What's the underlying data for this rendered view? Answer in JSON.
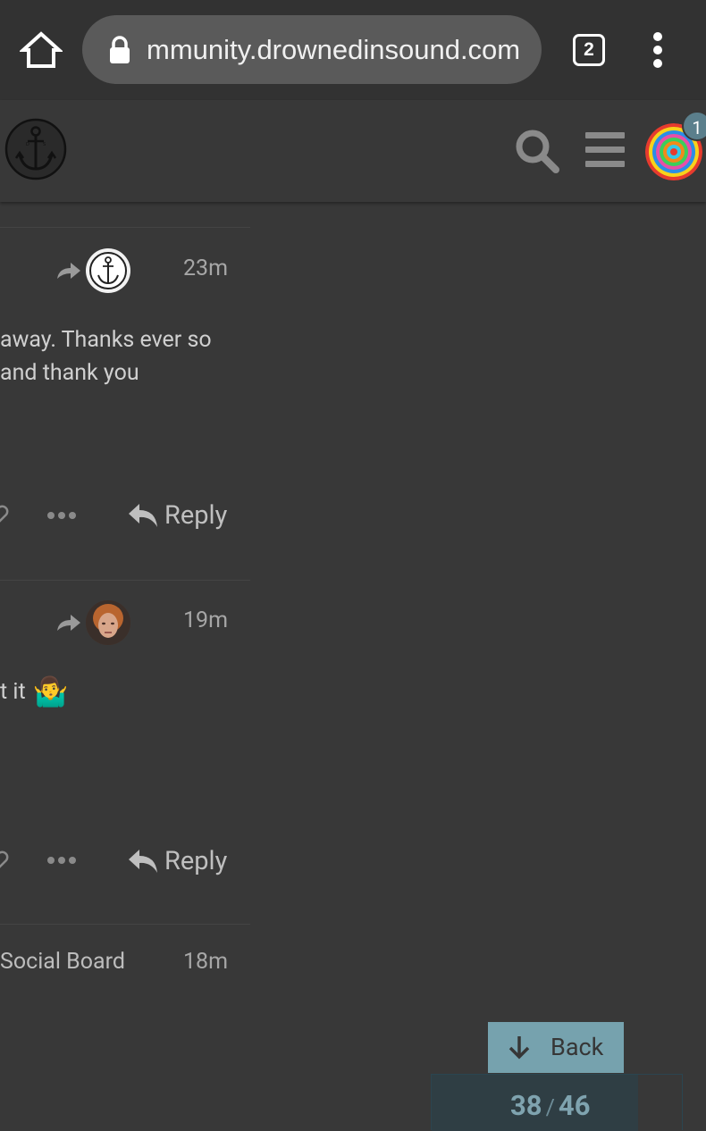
{
  "browser": {
    "url": "mmunity.drownedinsound.com",
    "tab_count": "2"
  },
  "header": {
    "notification_count": "1"
  },
  "posts": [
    {
      "timestamp": "23m",
      "lines": [
        "away. Thanks ever so",
        "and thank you"
      ],
      "reply_label": "Reply"
    },
    {
      "timestamp": "19m",
      "lines": [
        "t it"
      ],
      "emoji": "🤷‍♂️",
      "reply_label": "Reply"
    },
    {
      "category": "Social Board",
      "timestamp": "18m"
    }
  ],
  "navigation": {
    "back_label": "Back",
    "current_post": "38",
    "separator": "/",
    "total_posts": "46",
    "progress": 0.826
  },
  "colors": {
    "background": "#383838",
    "accent": "#76a2ae",
    "progress_text": "#7fa3af"
  }
}
